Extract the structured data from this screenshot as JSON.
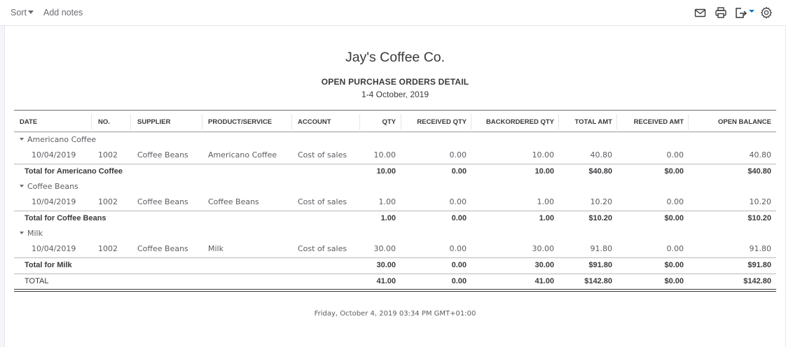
{
  "toolbar": {
    "sort_label": "Sort",
    "notes_label": "Add notes"
  },
  "icons": [
    "mail-icon",
    "print-icon",
    "export-icon",
    "settings-icon"
  ],
  "report": {
    "company": "Jay's Coffee Co.",
    "title": "OPEN PURCHASE ORDERS DETAIL",
    "period": "1-4 October, 2019",
    "footer": "Friday, October 4, 2019   03:34 PM GMT+01:00"
  },
  "columns": [
    "DATE",
    "NO.",
    "SUPPLIER",
    "PRODUCT/SERVICE",
    "ACCOUNT",
    "QTY",
    "RECEIVED QTY",
    "BACKORDERED QTY",
    "TOTAL AMT",
    "RECEIVED AMT",
    "OPEN BALANCE"
  ],
  "groups": [
    {
      "name": "Americano Coffee",
      "row": [
        "10/04/2019",
        "1002",
        "Coffee Beans",
        "Americano Coffee",
        "Cost of sales",
        "10.00",
        "0.00",
        "10.00",
        "40.80",
        "0.00",
        "40.80"
      ],
      "total": [
        "Total for Americano Coffee",
        "10.00",
        "0.00",
        "10.00",
        "$40.80",
        "$0.00",
        "$40.80"
      ]
    },
    {
      "name": "Coffee Beans",
      "row": [
        "10/04/2019",
        "1002",
        "Coffee Beans",
        "Coffee Beans",
        "Cost of sales",
        "1.00",
        "0.00",
        "1.00",
        "10.20",
        "0.00",
        "10.20"
      ],
      "total": [
        "Total for Coffee Beans",
        "1.00",
        "0.00",
        "1.00",
        "$10.20",
        "$0.00",
        "$10.20"
      ]
    },
    {
      "name": "Milk",
      "row": [
        "10/04/2019",
        "1002",
        "Coffee Beans",
        "Milk",
        "Cost of sales",
        "30.00",
        "0.00",
        "30.00",
        "91.80",
        "0.00",
        "91.80"
      ],
      "total": [
        "Total for Milk",
        "30.00",
        "0.00",
        "30.00",
        "$91.80",
        "$0.00",
        "$91.80"
      ]
    }
  ],
  "grand_total": [
    "TOTAL",
    "41.00",
    "0.00",
    "41.00",
    "$142.80",
    "$0.00",
    "$142.80"
  ]
}
